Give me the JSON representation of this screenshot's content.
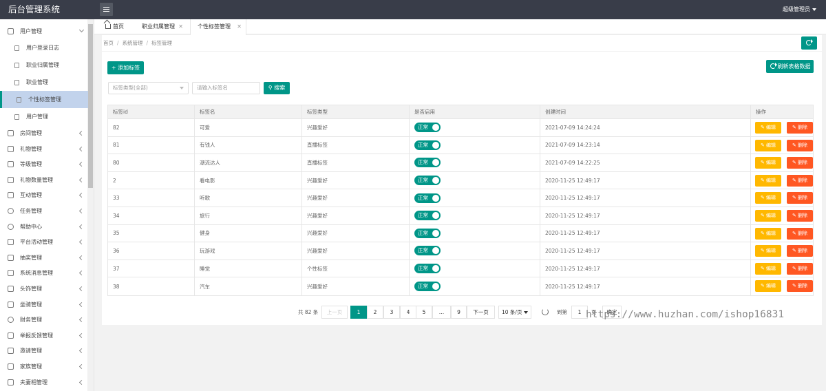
{
  "app": {
    "title": "后台管理系统",
    "user": "超级管理员"
  },
  "sidebar": {
    "user_group": {
      "label": "用户管理",
      "icon": "grid-icon"
    },
    "sub_items": [
      {
        "label": "用户登录日志",
        "active": false
      },
      {
        "label": "职业归属管理",
        "active": false
      },
      {
        "label": "职业管理",
        "active": false
      },
      {
        "label": "个性标签管理",
        "active": true
      },
      {
        "label": "用户管理",
        "active": false
      }
    ],
    "items": [
      {
        "label": "房间管理",
        "icon": "document-icon"
      },
      {
        "label": "礼物管理",
        "icon": "gift-icon"
      },
      {
        "label": "等级管理",
        "icon": "diamond-icon"
      },
      {
        "label": "礼物数量管理",
        "icon": "grid-icon"
      },
      {
        "label": "互动管理",
        "icon": "grid-icon"
      },
      {
        "label": "任务管理",
        "icon": "clock-icon"
      },
      {
        "label": "帮助中心",
        "icon": "help-icon"
      },
      {
        "label": "平台活动管理",
        "icon": "grid-icon"
      },
      {
        "label": "抽奖管理",
        "icon": "grid-icon"
      },
      {
        "label": "系统消息管理",
        "icon": "grid-icon"
      },
      {
        "label": "头饰管理",
        "icon": "grid-icon"
      },
      {
        "label": "坐骑管理",
        "icon": "grid-icon"
      },
      {
        "label": "财务管理",
        "icon": "dollar-icon"
      },
      {
        "label": "举报反馈管理",
        "icon": "warning-icon"
      },
      {
        "label": "邀请管理",
        "icon": "grid-icon"
      },
      {
        "label": "家族管理",
        "icon": "grid-icon"
      },
      {
        "label": "夫妻相管理",
        "icon": "grid-icon"
      }
    ]
  },
  "tabs": [
    {
      "label": "首页",
      "closable": false
    },
    {
      "label": "职业归属管理",
      "closable": true
    },
    {
      "label": "个性标签管理",
      "closable": true
    }
  ],
  "breadcrumb": [
    "首页",
    "系统管理",
    "标签管理"
  ],
  "toolbar": {
    "add_label": "+ 添加标签",
    "refresh_label": "刷新表格数据",
    "type_select": "标签类型(全部)",
    "name_placeholder": "请输入标签名",
    "search_label": "搜索"
  },
  "table": {
    "headers": [
      "标签id",
      "标签名",
      "标签类型",
      "是否启用",
      "创建时间",
      "操作"
    ],
    "edit_label": "编辑",
    "delete_label": "删除",
    "rows": [
      {
        "id": "82",
        "name": "可爱",
        "type": "兴趣爱好",
        "status": "正常",
        "created": "2021-07-09 14:24:24"
      },
      {
        "id": "81",
        "name": "有钱人",
        "type": "直播标签",
        "status": "正常",
        "created": "2021-07-09 14:23:14"
      },
      {
        "id": "80",
        "name": "潮流达人",
        "type": "直播标签",
        "status": "正常",
        "created": "2021-07-09 14:22:25"
      },
      {
        "id": "2",
        "name": "看电影",
        "type": "兴趣爱好",
        "status": "正常",
        "created": "2020-11-25 12:49:17"
      },
      {
        "id": "33",
        "name": "听歌",
        "type": "兴趣爱好",
        "status": "正常",
        "created": "2020-11-25 12:49:17"
      },
      {
        "id": "34",
        "name": "旅行",
        "type": "兴趣爱好",
        "status": "正常",
        "created": "2020-11-25 12:49:17"
      },
      {
        "id": "35",
        "name": "健身",
        "type": "兴趣爱好",
        "status": "正常",
        "created": "2020-11-25 12:49:17"
      },
      {
        "id": "36",
        "name": "玩游戏",
        "type": "兴趣爱好",
        "status": "正常",
        "created": "2020-11-25 12:49:17"
      },
      {
        "id": "37",
        "name": "睡觉",
        "type": "个性标签",
        "status": "正常",
        "created": "2020-11-25 12:49:17"
      },
      {
        "id": "38",
        "name": "汽车",
        "type": "兴趣爱好",
        "status": "正常",
        "created": "2020-11-25 12:49:17"
      }
    ]
  },
  "pagination": {
    "total": "共 82 条",
    "prev": "上一页",
    "pages": [
      "1",
      "2",
      "3",
      "4",
      "5",
      "…",
      "9"
    ],
    "current": "1",
    "next": "下一页",
    "per_page": "10 条/页",
    "goto_label": "到第",
    "goto_value": "1",
    "page_unit": "页",
    "confirm": "确定"
  },
  "watermark": "https://www.huzhan.com/ishop16831",
  "colors": {
    "primary": "#009688",
    "warning": "#ffb800",
    "danger": "#ff5722",
    "header": "#393d49",
    "active_menu": "#c2d3ec"
  }
}
